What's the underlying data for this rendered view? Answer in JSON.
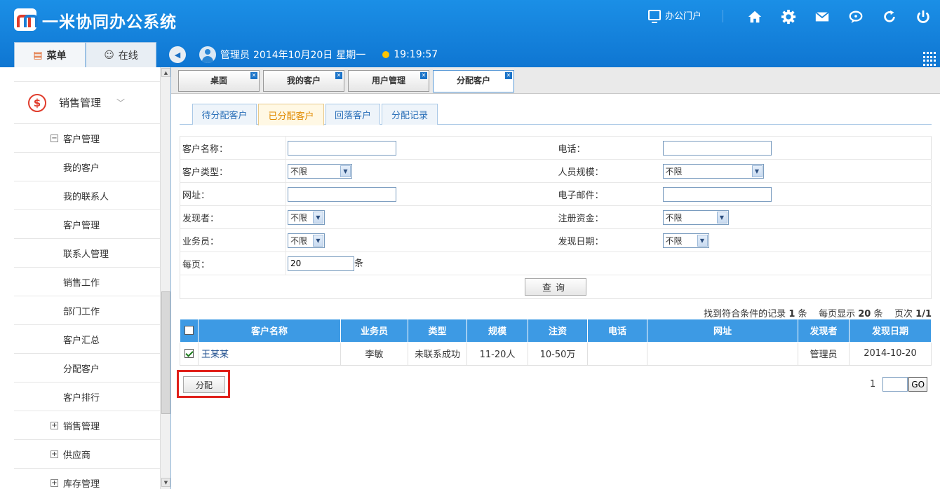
{
  "app": {
    "title": "一米协同办公系统"
  },
  "top": {
    "portal_label": "办公门户",
    "icons": [
      "home-icon",
      "gear-icon",
      "mail-icon",
      "chat-icon",
      "refresh-icon",
      "power-icon"
    ]
  },
  "side_tabs": [
    {
      "label": "菜单",
      "icon": "menu-icon",
      "active": true
    },
    {
      "label": "在线",
      "icon": "user-icon",
      "active": false
    }
  ],
  "user_bar": {
    "user": "管理员",
    "date": "2014年10月20日",
    "weekday": "星期一",
    "time": "19:19:57"
  },
  "sidebar": {
    "group": {
      "label": "销售管理",
      "icon": "dollar-icon"
    },
    "tree": [
      {
        "label": "客户管理",
        "level": 1,
        "toggle": "−"
      },
      {
        "label": "我的客户",
        "level": 2
      },
      {
        "label": "我的联系人",
        "level": 2
      },
      {
        "label": "客户管理",
        "level": 2
      },
      {
        "label": "联系人管理",
        "level": 2
      },
      {
        "label": "销售工作",
        "level": 2
      },
      {
        "label": "部门工作",
        "level": 2
      },
      {
        "label": "客户汇总",
        "level": 2
      },
      {
        "label": "分配客户",
        "level": 2
      },
      {
        "label": "客户排行",
        "level": 2
      },
      {
        "label": "销售管理",
        "level": 1,
        "toggle": "+"
      },
      {
        "label": "供应商",
        "level": 1,
        "toggle": "+"
      },
      {
        "label": "库存管理",
        "level": 1,
        "toggle": "+"
      }
    ]
  },
  "main_tabs": [
    {
      "label": "桌面",
      "active": false
    },
    {
      "label": "我的客户",
      "active": false
    },
    {
      "label": "用户管理",
      "active": false
    },
    {
      "label": "分配客户",
      "active": true
    }
  ],
  "sub_tabs": [
    {
      "label": "待分配客户",
      "active": false
    },
    {
      "label": "已分配客户",
      "active": true
    },
    {
      "label": "回落客户",
      "active": false
    },
    {
      "label": "分配记录",
      "active": false
    }
  ],
  "form": {
    "customer_name": {
      "label": "客户名称：",
      "value": ""
    },
    "phone": {
      "label": "电话：",
      "value": ""
    },
    "customer_type": {
      "label": "客户类型：",
      "value": "不限"
    },
    "staff_size": {
      "label": "人员规模：",
      "value": "不限"
    },
    "website": {
      "label": "网址：",
      "value": ""
    },
    "email": {
      "label": "电子邮件：",
      "value": ""
    },
    "discoverer": {
      "label": "发现者：",
      "value": "不限"
    },
    "capital": {
      "label": "注册资金：",
      "value": "不限"
    },
    "salesman": {
      "label": "业务员：",
      "value": "不限"
    },
    "discover_date": {
      "label": "发现日期：",
      "value": "不限"
    },
    "per_page": {
      "label": "每页：",
      "value": "20",
      "unit": "条"
    },
    "query_button": "查询"
  },
  "results": {
    "prefix": "找到符合条件的记录",
    "count": "1",
    "unit": "条",
    "per_page_label": "每页显示",
    "per_page": "20",
    "page_label": "页次",
    "page": "1/1"
  },
  "table": {
    "columns": [
      "客户名称",
      "业务员",
      "类型",
      "规模",
      "注资",
      "电话",
      "网址",
      "发现者",
      "发现日期"
    ],
    "rows": [
      {
        "name": "王某某",
        "salesman": "李敏",
        "type": "未联系成功",
        "scale": "11-20人",
        "capital": "10-50万",
        "phone": "",
        "website": "",
        "discoverer": "管理员",
        "date": "2014-10-20"
      }
    ]
  },
  "assign_button": "分配",
  "pager": {
    "current": "1",
    "go_label": "GO"
  }
}
